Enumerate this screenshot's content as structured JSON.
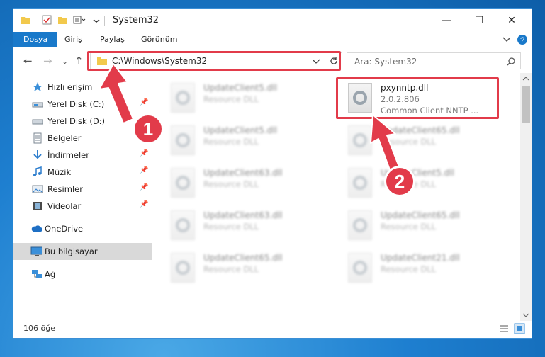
{
  "window": {
    "title": "System32",
    "tabs": [
      "Dosya",
      "Giriş",
      "Paylaş",
      "Görünüm"
    ],
    "active_tab": "Dosya"
  },
  "address_bar": {
    "path": "C:\\Windows\\System32"
  },
  "search": {
    "placeholder": "Ara: System32"
  },
  "sidebar": {
    "items": [
      {
        "label": "Hızlı erişim",
        "icon": "star-icon"
      },
      {
        "label": "Yerel Disk (C:)",
        "icon": "drive-icon",
        "pinned": true
      },
      {
        "label": "Yerel Disk (D:)",
        "icon": "drive-icon"
      },
      {
        "label": "Belgeler",
        "icon": "documents-icon"
      },
      {
        "label": "İndirmeler",
        "icon": "download-icon",
        "pinned": true
      },
      {
        "label": "Müzik",
        "icon": "music-icon",
        "pinned": true
      },
      {
        "label": "Resimler",
        "icon": "pictures-icon",
        "pinned": true
      },
      {
        "label": "Videolar",
        "icon": "video-icon",
        "pinned": true
      },
      {
        "label": "OneDrive",
        "icon": "cloud-icon"
      },
      {
        "label": "Bu bilgisayar",
        "icon": "computer-icon",
        "selected": true
      },
      {
        "label": "Ağ",
        "icon": "network-icon"
      }
    ]
  },
  "files": [
    {
      "name": "UpdateClient5.dll",
      "type": "Resource DLL",
      "blurred": true
    },
    {
      "name": "pxynntp.dll",
      "version": "2.0.2.806",
      "description": "Common Client NNTP ...",
      "highlighted": true
    },
    {
      "name": "UpdateClient5.dll",
      "type": "Resource DLL",
      "blurred": true
    },
    {
      "name": "UpdateClient65.dll",
      "type": "Resource DLL",
      "blurred": true
    },
    {
      "name": "UpdateClient63.dll",
      "type": "Resource DLL",
      "blurred": true
    },
    {
      "name": "UpdateClient5.dll",
      "type": "Resource DLL",
      "blurred": true
    },
    {
      "name": "UpdateClient63.dll",
      "type": "Resource DLL",
      "blurred": true
    },
    {
      "name": "UpdateClient65.dll",
      "type": "Resource DLL",
      "blurred": true
    },
    {
      "name": "UpdateClient65.dll",
      "type": "Resource DLL",
      "blurred": true
    },
    {
      "name": "UpdateClient21.dll",
      "type": "Resource DLL",
      "blurred": true
    }
  ],
  "status": {
    "item_count": "106 öğe"
  },
  "annotations": {
    "step1": "1",
    "step2": "2",
    "color": "#e23b4a"
  }
}
